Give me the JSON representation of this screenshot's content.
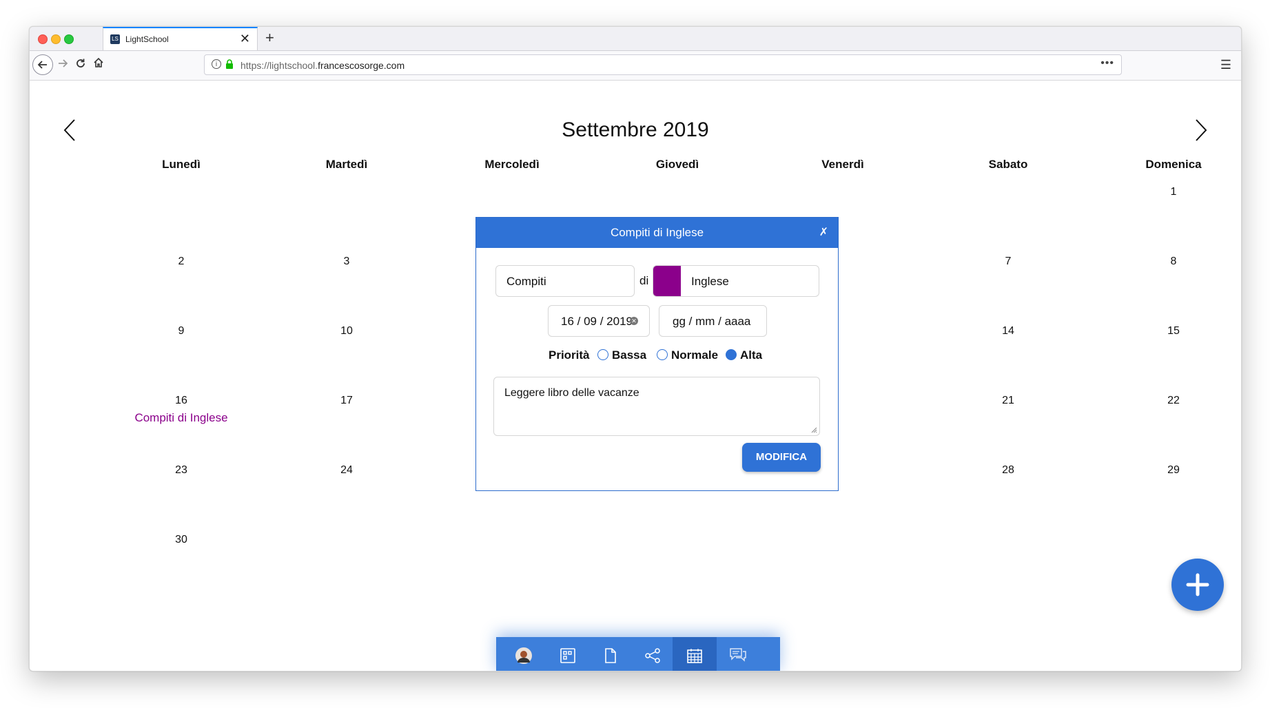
{
  "browser": {
    "tab_title": "LightSchool",
    "tab_favicon": "LS",
    "tab_close": "✕",
    "new_tab": "+",
    "url_prefix": "https://lightschool.",
    "url_host": "francescosorge.com",
    "url_more": "•••",
    "menu": "☰"
  },
  "calendar": {
    "title": "Settembre 2019",
    "weekdays": [
      "Lunedì",
      "Martedì",
      "Mercoledì",
      "Giovedì",
      "Venerdì",
      "Sabato",
      "Domenica"
    ],
    "days": {
      "d1": "1",
      "d2": "2",
      "d3": "3",
      "d7": "7",
      "d8": "8",
      "d9": "9",
      "d10": "10",
      "d14": "14",
      "d15": "15",
      "d16": "16",
      "d17": "17",
      "d21": "21",
      "d22": "22",
      "d23": "23",
      "d24": "24",
      "d28": "28",
      "d29": "29",
      "d30": "30"
    },
    "event_16": "Compiti di Inglese",
    "event_color": "#8b008b"
  },
  "modal": {
    "title": "Compiti di Inglese",
    "close": "✗",
    "type_value": "Compiti",
    "di_label": "di",
    "subject_value": "Inglese",
    "subject_color": "#8b008b",
    "date_value": "16 / 09 / 2019",
    "date2_placeholder": "gg / mm / aaaa",
    "priority_label": "Priorità",
    "priority_options": [
      "Bassa",
      "Normale",
      "Alta"
    ],
    "priority_selected": "Alta",
    "notes": "Leggere libro delle vacanze",
    "submit_label": "MODIFICA"
  },
  "colors": {
    "accent": "#2f72d6",
    "dock": "#3d7fdb"
  },
  "dock": {
    "items": [
      "avatar",
      "desktop-icon",
      "file-icon",
      "share-icon",
      "calendar-icon",
      "chat-icon"
    ],
    "active": "calendar-icon"
  }
}
